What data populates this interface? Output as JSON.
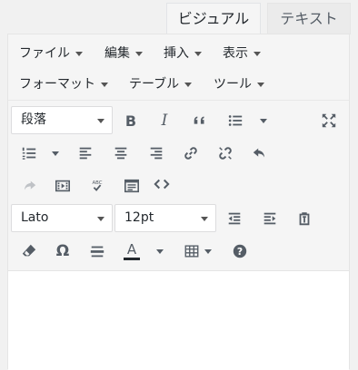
{
  "tabs": {
    "visual": "ビジュアル",
    "text": "テキスト"
  },
  "menu": {
    "file": "ファイル",
    "edit": "編集",
    "insert": "挿入",
    "view": "表示",
    "format": "フォーマット",
    "table": "テーブル",
    "tools": "ツール"
  },
  "toolbar": {
    "block_format": "段落",
    "font_family": "Lato",
    "font_size": "12pt",
    "spellcheck_label": "ABC",
    "font_color_letter": "A",
    "special_char": "Ω",
    "icons": [
      "bold-icon",
      "italic-icon",
      "blockquote-icon",
      "bullet-list-icon",
      "fullscreen-icon",
      "numbered-list-icon",
      "align-left-icon",
      "align-center-icon",
      "align-right-icon",
      "link-icon",
      "unlink-icon",
      "undo-icon",
      "redo-icon",
      "media-icon",
      "spellcheck-icon",
      "toolbar-toggle-icon",
      "code-icon",
      "outdent-icon",
      "indent-icon",
      "paste-text-icon",
      "clear-format-icon",
      "omega-icon",
      "hr-icon",
      "text-color-icon",
      "table-icon",
      "help-icon"
    ]
  },
  "colors": {
    "text_color_bar": "#23282d",
    "icon": "#555d66",
    "disabled": "#bfc2c6"
  }
}
